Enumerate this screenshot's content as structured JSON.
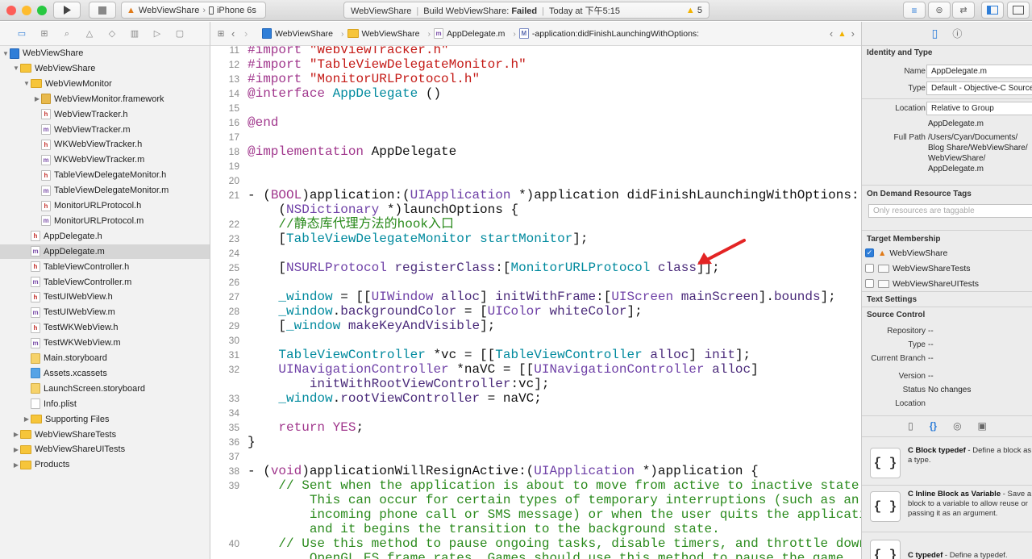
{
  "toolbar": {
    "run_icon": "play-icon",
    "stop_icon": "stop-icon",
    "scheme": "WebViewShare",
    "device": "iPhone 6s",
    "status_project": "WebViewShare",
    "status_build": "Build WebViewShare: ",
    "status_build_result": "Failed",
    "status_time": "Today at 下午5:15",
    "warning_count": "5",
    "colors": {
      "close": "#fd5d57",
      "minimize": "#febc2e",
      "zoom": "#27c840",
      "failed": "#000000"
    }
  },
  "navigator": {
    "tree": [
      {
        "label": "WebViewShare",
        "type": "proj",
        "level": 0,
        "open": true
      },
      {
        "label": "WebViewShare",
        "type": "folder",
        "level": 1,
        "open": true
      },
      {
        "label": "WebViewMonitor",
        "type": "folder",
        "level": 2,
        "open": true
      },
      {
        "label": "WebViewMonitor.framework",
        "type": "fw",
        "level": 3,
        "open": false
      },
      {
        "label": "WebViewTracker.h",
        "type": "h",
        "level": 3
      },
      {
        "label": "WebViewTracker.m",
        "type": "m",
        "level": 3
      },
      {
        "label": "WKWebViewTracker.h",
        "type": "h",
        "level": 3
      },
      {
        "label": "WKWebViewTracker.m",
        "type": "m",
        "level": 3
      },
      {
        "label": "TableViewDelegateMonitor.h",
        "type": "h",
        "level": 3
      },
      {
        "label": "TableViewDelegateMonitor.m",
        "type": "m",
        "level": 3
      },
      {
        "label": "MonitorURLProtocol.h",
        "type": "h",
        "level": 3
      },
      {
        "label": "MonitorURLProtocol.m",
        "type": "m",
        "level": 3
      },
      {
        "label": "AppDelegate.h",
        "type": "h",
        "level": 2
      },
      {
        "label": "AppDelegate.m",
        "type": "m",
        "level": 2,
        "selected": true
      },
      {
        "label": "TableViewController.h",
        "type": "h",
        "level": 2
      },
      {
        "label": "TableViewController.m",
        "type": "m",
        "level": 2
      },
      {
        "label": "TestUIWebView.h",
        "type": "h",
        "level": 2
      },
      {
        "label": "TestUIWebView.m",
        "type": "m",
        "level": 2
      },
      {
        "label": "TestWKWebView.h",
        "type": "h",
        "level": 2
      },
      {
        "label": "TestWKWebView.m",
        "type": "m",
        "level": 2
      },
      {
        "label": "Main.storyboard",
        "type": "sb",
        "level": 2
      },
      {
        "label": "Assets.xcassets",
        "type": "assets",
        "level": 2
      },
      {
        "label": "LaunchScreen.storyboard",
        "type": "sb",
        "level": 2
      },
      {
        "label": "Info.plist",
        "type": "plist",
        "level": 2
      },
      {
        "label": "Supporting Files",
        "type": "folder",
        "level": 2,
        "open": false
      },
      {
        "label": "WebViewShareTests",
        "type": "folder",
        "level": 1,
        "open": false
      },
      {
        "label": "WebViewShareUITests",
        "type": "folder",
        "level": 1,
        "open": false
      },
      {
        "label": "Products",
        "type": "folder",
        "level": 1,
        "open": false
      }
    ]
  },
  "jumpbar": {
    "items": [
      "WebViewShare",
      "WebViewShare",
      "AppDelegate.m",
      "-application:didFinishLaunchingWithOptions:"
    ]
  },
  "editor": {
    "lines": [
      {
        "n": "11",
        "html": "<span class='k'>#import</span> <span class='s'>\"WebViewTracker.h\"</span>"
      },
      {
        "n": "12",
        "html": "<span class='k'>#import</span> <span class='s'>\"TableViewDelegateMonitor.h\"</span>"
      },
      {
        "n": "13",
        "html": "<span class='k'>#import</span> <span class='s'>\"MonitorURLProtocol.h\"</span>"
      },
      {
        "n": "14",
        "html": "<span class='k'>@interface</span> <span class='ce'>AppDelegate</span> ()"
      },
      {
        "n": "15",
        "html": ""
      },
      {
        "n": "16",
        "html": "<span class='k'>@end</span>"
      },
      {
        "n": "17",
        "html": ""
      },
      {
        "n": "18",
        "html": "<span class='k'>@implementation</span> AppDelegate"
      },
      {
        "n": "19",
        "html": ""
      },
      {
        "n": "20",
        "html": ""
      },
      {
        "n": "21",
        "html": "- (<span class='k'>BOOL</span>)application:(<span class='t'>UIApplication</span> *)application didFinishLaunchingWithOptions:"
      },
      {
        "n": "",
        "html": "    (<span class='t'>NSDictionary</span> *)launchOptions {"
      },
      {
        "n": "22",
        "html": "    <span class='c'>//静态库代理方法的hook入口</span>"
      },
      {
        "n": "23",
        "html": "    [<span class='ce'>TableViewDelegateMonitor</span> <span class='ce'>startMonitor</span>];"
      },
      {
        "n": "24",
        "html": ""
      },
      {
        "n": "25",
        "html": "    [<span class='t'>NSURLProtocol</span> <span class='p'>registerClass</span>:[<span class='ce'>MonitorURLProtocol</span> <span class='p'>class</span>]];"
      },
      {
        "n": "26",
        "html": ""
      },
      {
        "n": "27",
        "html": "    <span class='ce'>_window</span> = [[<span class='t'>UIWindow</span> <span class='p'>alloc</span>] <span class='p'>initWithFrame</span>:[<span class='t'>UIScreen</span> <span class='p'>mainScreen</span>].<span class='p'>bounds</span>];"
      },
      {
        "n": "28",
        "html": "    <span class='ce'>_window</span>.<span class='p'>backgroundColor</span> = [<span class='t'>UIColor</span> <span class='p'>whiteColor</span>];"
      },
      {
        "n": "29",
        "html": "    [<span class='ce'>_window</span> <span class='p'>makeKeyAndVisible</span>];"
      },
      {
        "n": "30",
        "html": ""
      },
      {
        "n": "31",
        "html": "    <span class='ce'>TableViewController</span> *vc = [[<span class='ce'>TableViewController</span> <span class='p'>alloc</span>] <span class='p'>init</span>];"
      },
      {
        "n": "32",
        "html": "    <span class='t'>UINavigationController</span> *naVC = [[<span class='t'>UINavigationController</span> <span class='p'>alloc</span>]"
      },
      {
        "n": "",
        "html": "        <span class='p'>initWithRootViewController</span>:vc];"
      },
      {
        "n": "33",
        "html": "    <span class='ce'>_window</span>.<span class='p'>rootViewController</span> = naVC;"
      },
      {
        "n": "34",
        "html": ""
      },
      {
        "n": "35",
        "html": "    <span class='k'>return</span> <span class='k'>YES</span>;"
      },
      {
        "n": "36",
        "html": "}"
      },
      {
        "n": "37",
        "html": ""
      },
      {
        "n": "38",
        "html": "- (<span class='k'>void</span>)applicationWillResignActive:(<span class='t'>UIApplication</span> *)application {"
      },
      {
        "n": "39",
        "html": "    <span class='c'>// Sent when the application is about to move from active to inactive state.</span>"
      },
      {
        "n": "",
        "html": "        <span class='c'>This can occur for certain types of temporary interruptions (such as an</span>"
      },
      {
        "n": "",
        "html": "        <span class='c'>incoming phone call or SMS message) or when the user quits the application</span>"
      },
      {
        "n": "",
        "html": "        <span class='c'>and it begins the transition to the background state.</span>"
      },
      {
        "n": "40",
        "html": "    <span class='c'>// Use this method to pause ongoing tasks, disable timers, and throttle down</span>"
      },
      {
        "n": "",
        "html": "        <span class='c'>OpenGL ES frame rates. Games should use this method to pause the game.</span>"
      }
    ]
  },
  "inspector": {
    "identity_title": "Identity and Type",
    "name_label": "Name",
    "name_value": "AppDelegate.m",
    "type_label": "Type",
    "type_value": "Default - Objective-C Source",
    "location_label": "Location",
    "location_value": "Relative to Group",
    "location_file": "AppDelegate.m",
    "fullpath_label": "Full Path",
    "fullpath_lines": [
      "/Users/Cyan/Documents/",
      "Blog Share/WebViewShare/",
      "WebViewShare/",
      "AppDelegate.m"
    ],
    "odr_title": "On Demand Resource Tags",
    "odr_placeholder": "Only resources are taggable",
    "target_title": "Target Membership",
    "targets": [
      {
        "name": "WebViewShare",
        "checked": true
      },
      {
        "name": "WebViewShareTests",
        "checked": false
      },
      {
        "name": "WebViewShareUITests",
        "checked": false
      }
    ],
    "text_settings_title": "Text Settings",
    "source_control_title": "Source Control",
    "repo_label": "Repository",
    "repo_value": "--",
    "sc_type_label": "Type",
    "sc_type_value": "--",
    "branch_label": "Current Branch",
    "branch_value": "--",
    "version_label": "Version",
    "version_value": "--",
    "status_label": "Status",
    "status_value": "No changes",
    "sc_location_label": "Location",
    "snippets": [
      {
        "title": "C Block typedef",
        "desc": " - Define a block as a type."
      },
      {
        "title": "C Inline Block as Variable",
        "desc": " - Save a block to a variable to allow reuse or passing it as an argument."
      },
      {
        "title": "C typedef",
        "desc": " - Define a typedef."
      }
    ],
    "snippet_glyph": "{ }"
  }
}
